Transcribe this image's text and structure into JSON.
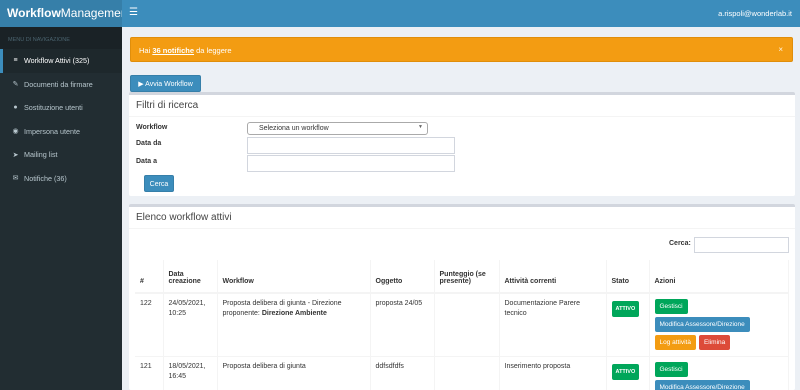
{
  "brand": {
    "bold": "Workflow",
    "rest": "Management"
  },
  "topbar": {
    "user": "a.rispoli@wonderlab.it"
  },
  "sidebar": {
    "header": "MENU DI NAVIGAZIONE",
    "items": [
      {
        "label": "Workflow Attivi (325)",
        "icon": "tasks-icon"
      },
      {
        "label": "Documenti da firmare",
        "icon": "edit-icon"
      },
      {
        "label": "Sostituzione utenti",
        "icon": "users-icon"
      },
      {
        "label": "Impersona utente",
        "icon": "eye-icon"
      },
      {
        "label": "Mailing list",
        "icon": "send-icon"
      },
      {
        "label": "Notifiche (36)",
        "icon": "envelope-icon"
      }
    ]
  },
  "alert": {
    "prefix": "Hai ",
    "count": "36 notifiche",
    "suffix": " da leggere",
    "close": "×"
  },
  "start_button": "Avvia Workflow",
  "filters": {
    "title": "Filtri di ricerca",
    "workflow_label": "Workflow",
    "workflow_value": "Seleziona un workflow",
    "date_from_label": "Data da",
    "date_to_label": "Data a",
    "search_button": "Cerca"
  },
  "list": {
    "title": "Elenco workflow attivi",
    "search_label": "Cerca:",
    "headers": [
      "#",
      "Data creazione",
      "Workflow",
      "Oggetto",
      "Punteggio (se presente)",
      "Attività correnti",
      "Stato",
      "Azioni"
    ],
    "rows": [
      {
        "id": "122",
        "date": "24/05/2021, 10:25",
        "workflow": "Proposta delibera di giunta - Direzione proponente: ",
        "workflow_bold": "Direzione Ambiente",
        "object": "proposta 24/05",
        "score": "",
        "activity": "Documentazione Parere tecnico",
        "status": "ATTIVO",
        "actions": {
          "manage": "Gestisci",
          "edit": "Modifica Assessore/Direzione",
          "log": "Log attività",
          "delete": "Elimina"
        }
      },
      {
        "id": "121",
        "date": "18/05/2021, 16:45",
        "workflow": "Proposta delibera di giunta",
        "workflow_bold": "",
        "object": "ddfsdfdfs",
        "score": "",
        "activity": "Inserimento proposta",
        "status": "ATTIVO",
        "actions": {
          "manage": "Gestisci",
          "edit": "Modifica Assessore/Direzione"
        }
      }
    ]
  }
}
